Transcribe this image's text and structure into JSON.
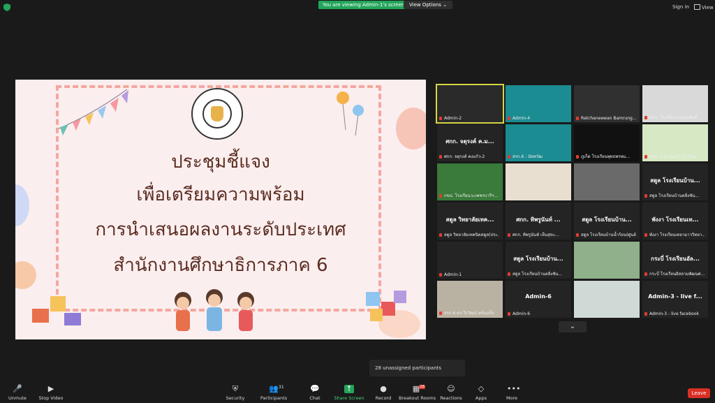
{
  "topbar": {
    "viewing_badge": "You are viewing Admin-1's screen",
    "view_options": "View Options ⌄",
    "sign_in": "Sign in",
    "view": "View"
  },
  "slide": {
    "line1": "ประชุมชี้แจง",
    "line2": "เพื่อเตรียมความพร้อม",
    "line3": "การนำเสนอผลงานระดับประเทศ",
    "line4": "สำนักงานศึกษาธิการภาค 6"
  },
  "gallery": {
    "tiles": [
      {
        "name": "Admin-2",
        "center": "",
        "bg": "#2a2a2a",
        "active": true
      },
      {
        "name": "Admin-4",
        "center": "",
        "bg": "#1b8c91",
        "active": false
      },
      {
        "name": "Ratchaneewan Bamrung...",
        "center": "",
        "bg": "#303030",
        "active": false
      },
      {
        "name": "พชร. โรงเรียนกาญจนสิทธิ์...",
        "center": "",
        "bg": "#d9d9d9",
        "active": false
      },
      {
        "name": "ศกก. จตุรงค์ คงแก้ว-2",
        "center": "ศกก. จตุรงค์ ค.ม...",
        "bg": "#242424",
        "active": false
      },
      {
        "name": "สรก.6 : นัททวัฒ",
        "center": "",
        "bg": "#1b8c91",
        "active": false
      },
      {
        "name": "ภูเก็ต โรงเรียนพุทธพรหม...",
        "center": "",
        "bg": "#111111",
        "active": false
      },
      {
        "name": "ศกก. ผ.ศ.อรุณ(รับรู้) กินน...",
        "center": "",
        "bg": "#d6e8c4",
        "active": false
      },
      {
        "name": "กขป. โรงเรียนวะเพชรบารีฯ...",
        "center": "",
        "bg": "#3a7a3a",
        "active": false
      },
      {
        "name": "",
        "center": "",
        "bg": "#e9dfd0",
        "active": false
      },
      {
        "name": "",
        "center": "",
        "bg": "#6a6a6a",
        "active": false
      },
      {
        "name": "สตูล โรงเรียนบ้านตลิ่งชัน...",
        "center": "สตูล โรงเรียนบ้าน...",
        "bg": "#242424",
        "active": false
      },
      {
        "name": "สตูล วิทยาลัยเทคนิคสตูล(ประ...",
        "center": "สตูล วิทยาลัยเทค...",
        "bg": "#242424",
        "active": false
      },
      {
        "name": "ศกก. ทิพรูนันท์ เห็นสุขะ...",
        "center": "ศกก. ทิพรูนันท์ ...",
        "bg": "#242424",
        "active": false
      },
      {
        "name": "สตูล โรงเรียนบ้านน้ำร้อน(ศูนย์...",
        "center": "สตูล โรงเรียนบ้าน...",
        "bg": "#242424",
        "active": false
      },
      {
        "name": "พังงา โรงเรียนเทอามาววิทยา...",
        "center": "พังงา โรงเรียนเท...",
        "bg": "#242424",
        "active": false
      },
      {
        "name": "Admin-1",
        "center": "",
        "bg": "#242424",
        "active": false
      },
      {
        "name": "สตูล โรงเรียนบ้านตลิ่งชัน...",
        "center": "สตูล โรงเรียนบ้าน...",
        "bg": "#242424",
        "active": false
      },
      {
        "name": "",
        "center": "",
        "bg": "#8fb08a",
        "active": false
      },
      {
        "name": "กระบี่ โรงเรียนอิสลามพัฒนศ...",
        "center": "กระบี่ โรงเรียนอัล...",
        "bg": "#242424",
        "active": false
      },
      {
        "name": "สรก.6 ดร.วีรวัฒน์ หนั่นแข็ง",
        "center": "",
        "bg": "#b9b2a2",
        "active": false
      },
      {
        "name": "Admin-6",
        "center": "Admin-6",
        "bg": "#242424",
        "active": false
      },
      {
        "name": "",
        "center": "",
        "bg": "#cfd9d5",
        "active": false
      },
      {
        "name": "Admin-3 - live facebook",
        "center": "Admin-3 - live f...",
        "bg": "#242424",
        "active": false
      }
    ]
  },
  "unassigned": "28 unassigned participants",
  "toolbar": {
    "items": [
      {
        "id": "unmute",
        "label": "Unmute",
        "icon": "🎤"
      },
      {
        "id": "stop-video",
        "label": "Stop Video",
        "icon": "▶"
      },
      {
        "id": "security",
        "label": "Security",
        "icon": "⛨"
      },
      {
        "id": "participants",
        "label": "Participants",
        "icon": "👥",
        "count": "31"
      },
      {
        "id": "chat",
        "label": "Chat",
        "icon": "💬"
      },
      {
        "id": "share-screen",
        "label": "Share Screen",
        "icon": "↑"
      },
      {
        "id": "record",
        "label": "Record",
        "icon": "●"
      },
      {
        "id": "breakout-rooms",
        "label": "Breakout Rooms",
        "icon": "▦",
        "badge": "28"
      },
      {
        "id": "reactions",
        "label": "Reactions",
        "icon": "☺"
      },
      {
        "id": "apps",
        "label": "Apps",
        "icon": "◇"
      },
      {
        "id": "more",
        "label": "More",
        "icon": "•••"
      }
    ],
    "leave": "Leave"
  }
}
